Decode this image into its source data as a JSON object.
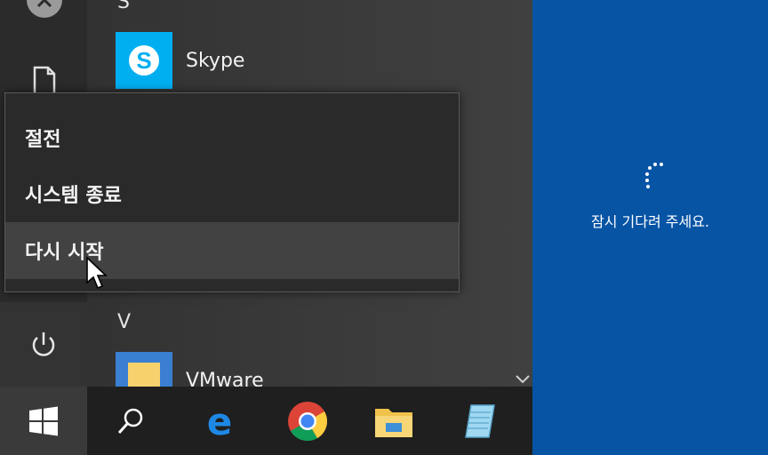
{
  "app_list": {
    "groups": [
      {
        "letter": "S",
        "apps": [
          {
            "name": "Skype"
          }
        ]
      },
      {
        "letter": "V",
        "apps": [
          {
            "name": "VMware"
          }
        ]
      }
    ]
  },
  "power_menu": {
    "items": [
      {
        "label": "절전"
      },
      {
        "label": "시스템 종료"
      },
      {
        "label": "다시 시작"
      }
    ]
  },
  "restart_overlay": {
    "message": "잠시 기다려 주세요."
  },
  "taskbar": {
    "items": [
      "start-icon",
      "search-icon",
      "edge-icon",
      "chrome-icon",
      "file-explorer-icon",
      "notepad-icon"
    ]
  },
  "colors": {
    "start_bg": "#2f2f2f",
    "restart_bg": "#0754a5",
    "skype_blue": "#00aff0"
  }
}
